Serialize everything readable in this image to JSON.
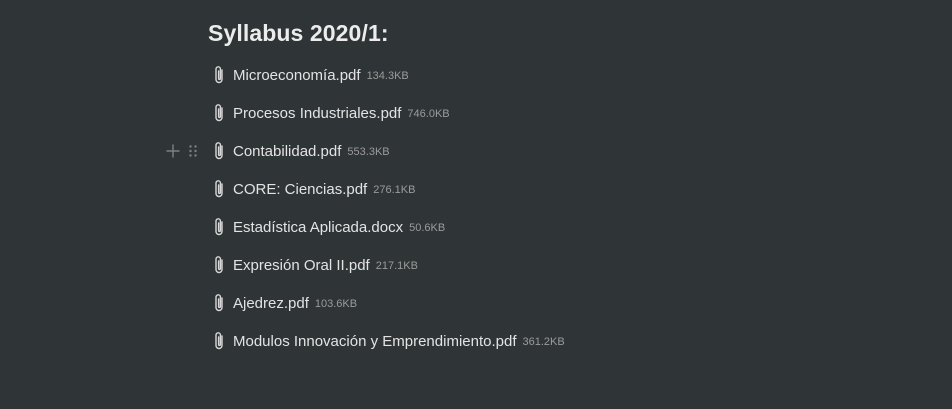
{
  "page": {
    "heading": "Syllabus 2020/1:"
  },
  "files": [
    {
      "name": "Microeconomía.pdf",
      "size": "134.3KB",
      "icon": "paperclip-icon"
    },
    {
      "name": "Procesos Industriales.pdf",
      "size": "746.0KB",
      "icon": "paperclip-icon"
    },
    {
      "name": "Contabilidad.pdf",
      "size": "553.3KB",
      "icon": "paperclip-icon"
    },
    {
      "name": "CORE: Ciencias.pdf",
      "size": "276.1KB",
      "icon": "paperclip-icon"
    },
    {
      "name": "Estadística Aplicada.docx",
      "size": "50.6KB",
      "icon": "paperclip-icon"
    },
    {
      "name": "Expresión Oral II.pdf",
      "size": "217.1KB",
      "icon": "paperclip-icon"
    },
    {
      "name": "Ajedrez.pdf",
      "size": "103.6KB",
      "icon": "paperclip-icon"
    },
    {
      "name": "Modulos Innovación y Emprendimiento.pdf",
      "size": "361.2KB",
      "icon": "paperclip-icon"
    }
  ],
  "block_controls": {
    "add_icon": "plus-icon",
    "drag_icon": "drag-handle-icon"
  },
  "colors": {
    "background": "#2f3437",
    "text": "#e3e3e3",
    "muted": "#9b9b9b"
  }
}
